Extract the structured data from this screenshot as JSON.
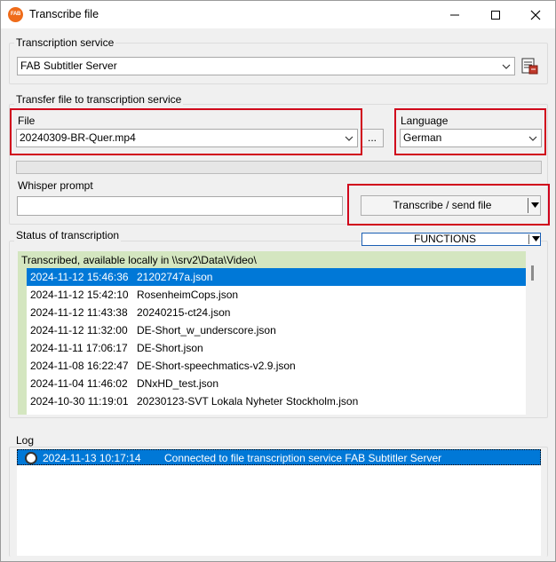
{
  "window": {
    "title": "Transcribe file",
    "app_icon_text": "FAB"
  },
  "service": {
    "label": "Transcription service",
    "value": "FAB Subtitler Server"
  },
  "transfer": {
    "label": "Transfer file to transcription service",
    "file_label": "File",
    "file_value": "20240309-BR-Quer.mp4",
    "browse_label": "...",
    "language_label": "Language",
    "language_value": "German",
    "progress_percent": 0,
    "whisper_label": "Whisper prompt",
    "whisper_value": "",
    "send_label": "Transcribe / send file"
  },
  "status": {
    "label": "Status of transcription",
    "functions_label": "FUNCTIONS",
    "header": "Transcribed, available locally in \\\\srv2\\Data\\Video\\",
    "items": [
      {
        "date": "2024-11-12 15:46:36",
        "name": "21202747a.json",
        "selected": true
      },
      {
        "date": "2024-11-12 15:42:10",
        "name": "RosenheimCops.json"
      },
      {
        "date": "2024-11-12 11:43:38",
        "name": "20240215-ct24.json"
      },
      {
        "date": "2024-11-12 11:32:00",
        "name": "DE-Short_w_underscore.json"
      },
      {
        "date": "2024-11-11 17:06:17",
        "name": "DE-Short.json"
      },
      {
        "date": "2024-11-08 16:22:47",
        "name": "DE-Short-speechmatics-v2.9.json"
      },
      {
        "date": "2024-11-04 11:46:02",
        "name": "DNxHD_test.json"
      },
      {
        "date": "2024-10-30 11:19:01",
        "name": "20230123-SVT Lokala Nyheter Stockholm.json"
      }
    ]
  },
  "log": {
    "label": "Log",
    "entries": [
      {
        "time": "2024-11-13 10:17:14",
        "message": "Connected to file transcription service  FAB Subtitler Server"
      }
    ]
  },
  "colors": {
    "highlight": "#0078d7",
    "status_panel": "#d4e6c0",
    "annotation_red": "#d0021b",
    "app_icon": "#ef6c1a"
  }
}
